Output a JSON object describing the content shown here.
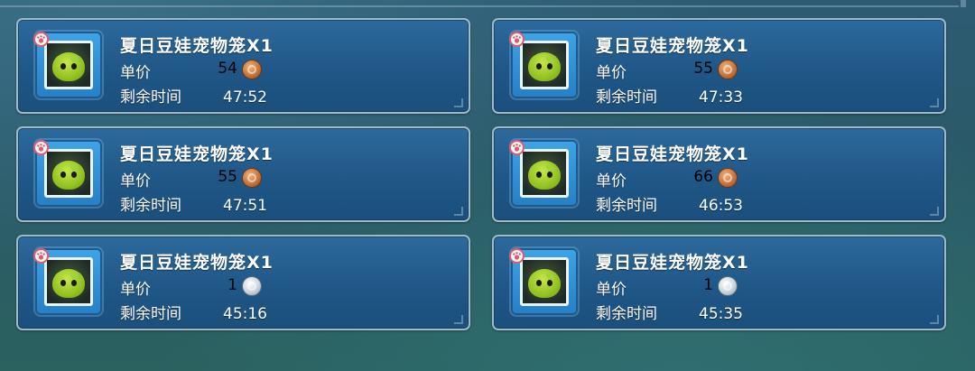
{
  "labels": {
    "price": "单价",
    "time_left": "剩余时间"
  },
  "listings": [
    {
      "title": "夏日豆娃宠物笼X1",
      "price": "54",
      "currency_icon": "bronze-coin-icon",
      "time_left": "47:52"
    },
    {
      "title": "夏日豆娃宠物笼X1",
      "price": "55",
      "currency_icon": "bronze-coin-icon",
      "time_left": "47:33"
    },
    {
      "title": "夏日豆娃宠物笼X1",
      "price": "55",
      "currency_icon": "bronze-coin-icon",
      "time_left": "47:51"
    },
    {
      "title": "夏日豆娃宠物笼X1",
      "price": "66",
      "currency_icon": "bronze-coin-icon",
      "time_left": "46:53"
    },
    {
      "title": "夏日豆娃宠物笼X1",
      "price": "1",
      "currency_icon": "silver-coin-icon",
      "time_left": "45:16"
    },
    {
      "title": "夏日豆娃宠物笼X1",
      "price": "1",
      "currency_icon": "silver-coin-icon",
      "time_left": "45:35"
    }
  ],
  "colors": {
    "card_bg": "#1f5787",
    "card_border": "#9fb9c8",
    "bronze_coin": "#c7743a",
    "silver_coin": "#c9d4dc",
    "paw_badge": "#e05a6e"
  }
}
